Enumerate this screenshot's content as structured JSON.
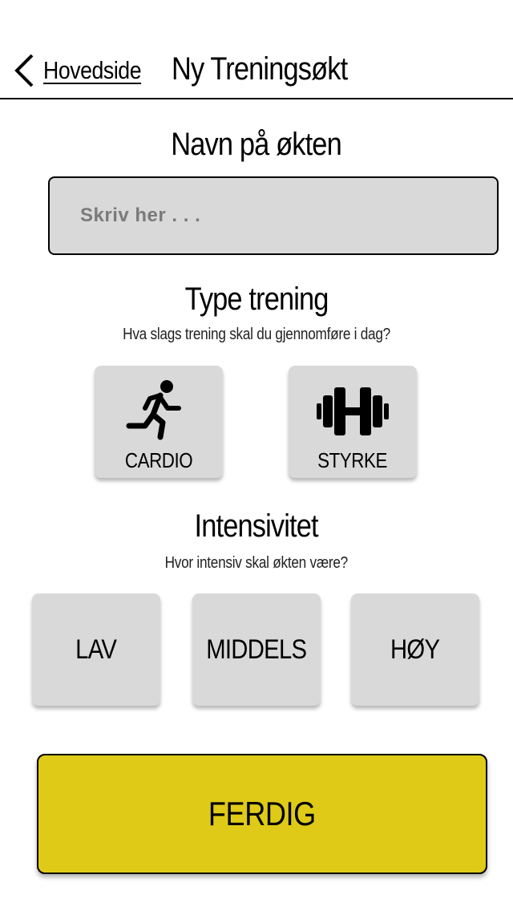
{
  "header": {
    "back_label": "Hovedside",
    "title": "Ny Treningsøkt"
  },
  "name_section": {
    "title": "Navn på økten",
    "placeholder": "Skriv her . . ."
  },
  "type_section": {
    "title": "Type trening",
    "subtitle": "Hva slags trening skal du gjennomføre i dag?",
    "options": [
      {
        "label": "CARDIO",
        "icon": "running-person-icon"
      },
      {
        "label": "STYRKE",
        "icon": "dumbbell-icon"
      }
    ]
  },
  "intensity_section": {
    "title": "Intensivitet",
    "subtitle": "Hvor intensiv skal økten være?",
    "options": [
      {
        "label": "LAV"
      },
      {
        "label": "MIDDELS"
      },
      {
        "label": "HØY"
      }
    ]
  },
  "finish_label": "FERDIG",
  "colors": {
    "accent": "#dfcb17",
    "tile": "#d9d9d9",
    "input": "#d9d9d9"
  }
}
